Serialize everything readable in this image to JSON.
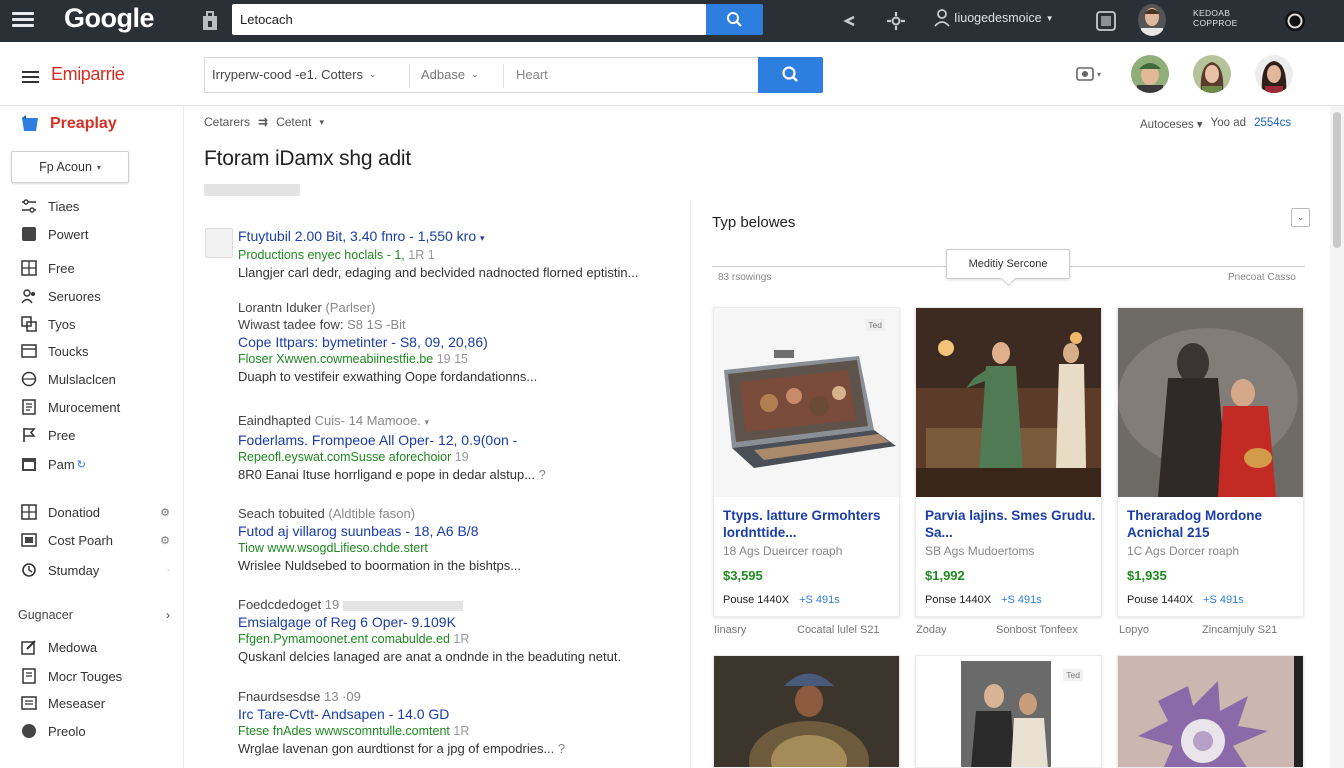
{
  "topbar": {
    "logo": "Google",
    "search_value": "Letocach",
    "user_label": "Iiuogedesmoice",
    "brand_line1": "KEDOAB",
    "brand_line2": "COPPROE"
  },
  "header": {
    "app_title": "Emiparrie",
    "search_segment1": "Irryperw-cood -e1. Cotters",
    "search_segment2": "Adbase",
    "search_segment3": "Heart"
  },
  "sidebar": {
    "brand_label": "Preaplay",
    "account_button": "Fp Acoun",
    "items": [
      {
        "label": "Tiaes",
        "icon": "sliders-icon"
      },
      {
        "label": "Powert",
        "icon": "square-icon"
      },
      {
        "label": "Free",
        "icon": "grid-icon"
      },
      {
        "label": "Seruores",
        "icon": "users-icon"
      },
      {
        "label": "Tyos",
        "icon": "layers-icon"
      },
      {
        "label": "Toucks",
        "icon": "box-icon"
      },
      {
        "label": "Mulslaclcen",
        "icon": "globe-icon"
      },
      {
        "label": "Murocement",
        "icon": "document-icon"
      },
      {
        "label": "Pree",
        "icon": "flag-icon"
      },
      {
        "label": "Pam",
        "icon": "calendar-icon"
      },
      {
        "label": "Donatiod",
        "icon": "grid-icon"
      },
      {
        "label": "Cost Poarh",
        "icon": "book-icon"
      },
      {
        "label": "Stumday",
        "icon": "refresh-icon"
      },
      {
        "label": "Medowa",
        "icon": "pencil-icon"
      },
      {
        "label": "Mocr Touges",
        "icon": "document-icon"
      },
      {
        "label": "Meseaser",
        "icon": "list-icon"
      },
      {
        "label": "Preolo",
        "icon": "circle-icon"
      }
    ],
    "section_label": "Gugnacer"
  },
  "main": {
    "crumb1": "Cetarers",
    "crumb2": "Cetent",
    "toolbar_label": "Autoceses",
    "toolbar_mid": "Yoo ad",
    "toolbar_count": "2554cs",
    "page_title": "Ftoram iDamx shg adit",
    "results": [
      {
        "head": "",
        "head_muted": "",
        "link": "Ftuytubil 2.00 Bit, 3.40 fnro - 1,550 kro",
        "url": "Productions enyec hoclals - 1,",
        "url_muted": "1R 1",
        "snippet": "Llangjer carl dedr, edaging and beclvided nadnocted florned eptistin...",
        "snippet_muted": ""
      },
      {
        "head": "Lorantn Iduker",
        "head_muted": "(Parlser)",
        "link": "Cope Ittpars: bymetinter - S8, 09, 20,86)",
        "url": "Floser Xwwen.cowmeabiinestfie.be",
        "url_muted": "19 15",
        "snippet": "Duaph to vestifeir exwathing Oope fordandationns...",
        "snippet_muted": "",
        "pre": "Wiwast tadee fow:",
        "pre_muted": "S8 1S -Bit"
      },
      {
        "head": "Eaindhapted",
        "head_muted": "Cuis- 14 Mamooe.",
        "link": "Foderlams. Frompeoe All Oper- 12, 0.9(0on -",
        "url": "Repeofl.eyswat.comSusse aforechoior",
        "url_muted": "19",
        "snippet": "8R0 Eanai Ituse horrligand e pope in dedar alstup...",
        "snippet_muted": "?"
      },
      {
        "head": "Seach tobuited",
        "head_muted": "(Aldtible fason)",
        "link": "Futod aj villarog suunbeas - 18, A6 B/8",
        "url": "Tiow www.wsogdLifieso.chde.stert",
        "url_muted": "",
        "snippet": "Wrislee Nuldsebed to boormation in the bishtps...",
        "snippet_muted": ""
      },
      {
        "head": "Foedcdedoget",
        "head_muted": "19",
        "link": "Emsialgage of Reg 6 Oper- 9.109K",
        "url": "Ffgen.Pymamoonet.ent comabulde.ed",
        "url_muted": "1R",
        "snippet": "Quskanl delcies lanaged are anat a ondnde in the beaduting netut.",
        "snippet_muted": ""
      },
      {
        "head": "Fnaurdsesdse",
        "head_muted": "13 ·09",
        "link": "Irc Tare-Cvtt- Andsapen - 14.0 GD",
        "url": "Ftese fnAdes wwwscomntulle.comtent",
        "url_muted": "1R",
        "snippet": "Wrglae lavenan gon aurdtionst for a jpg of empodries...",
        "snippet_muted": "?"
      }
    ]
  },
  "panel": {
    "title": "Typ belowes",
    "tooltip": "Meditiy Sercone",
    "sub_left": "83 rsowings",
    "sub_right": "Pnecoat Casso",
    "cards": [
      {
        "tag": "Ted",
        "title": "Ttyps. latture Grmohters lordnttide...",
        "meta": "18 Ags Dueircer roaph",
        "price": "$3,595",
        "foot": "Pouse 1440X",
        "action": "+S 491s",
        "below_left": "Iinasry",
        "below_right": "Cocatal lulel S21"
      },
      {
        "tag": "",
        "title": "Parvia lajins. Smes Grudu. Sa...",
        "meta": "SB Ags Mudoertoms",
        "price": "$1,992",
        "foot": "Ponse 1440X",
        "action": "+S 491s",
        "below_left": "Zoday",
        "below_right": "Sonbost Tonfeex"
      },
      {
        "tag": "",
        "title": "Theraradog Mordone Acnichal 215",
        "meta": "1C Ags Dorcer roaph",
        "price": "$1,935",
        "foot": "Pouse 1440X",
        "action": "+S 491s",
        "below_left": "Lopyo",
        "below_right": "Zincamjuly S21"
      }
    ],
    "card2_tag": "Ted"
  },
  "colors": {
    "accent_blue": "#2e7ee0",
    "link_blue": "#1a3da8",
    "url_green": "#1e8a1e",
    "brand_red": "#d93025",
    "topbar_bg": "#2b2f36"
  }
}
